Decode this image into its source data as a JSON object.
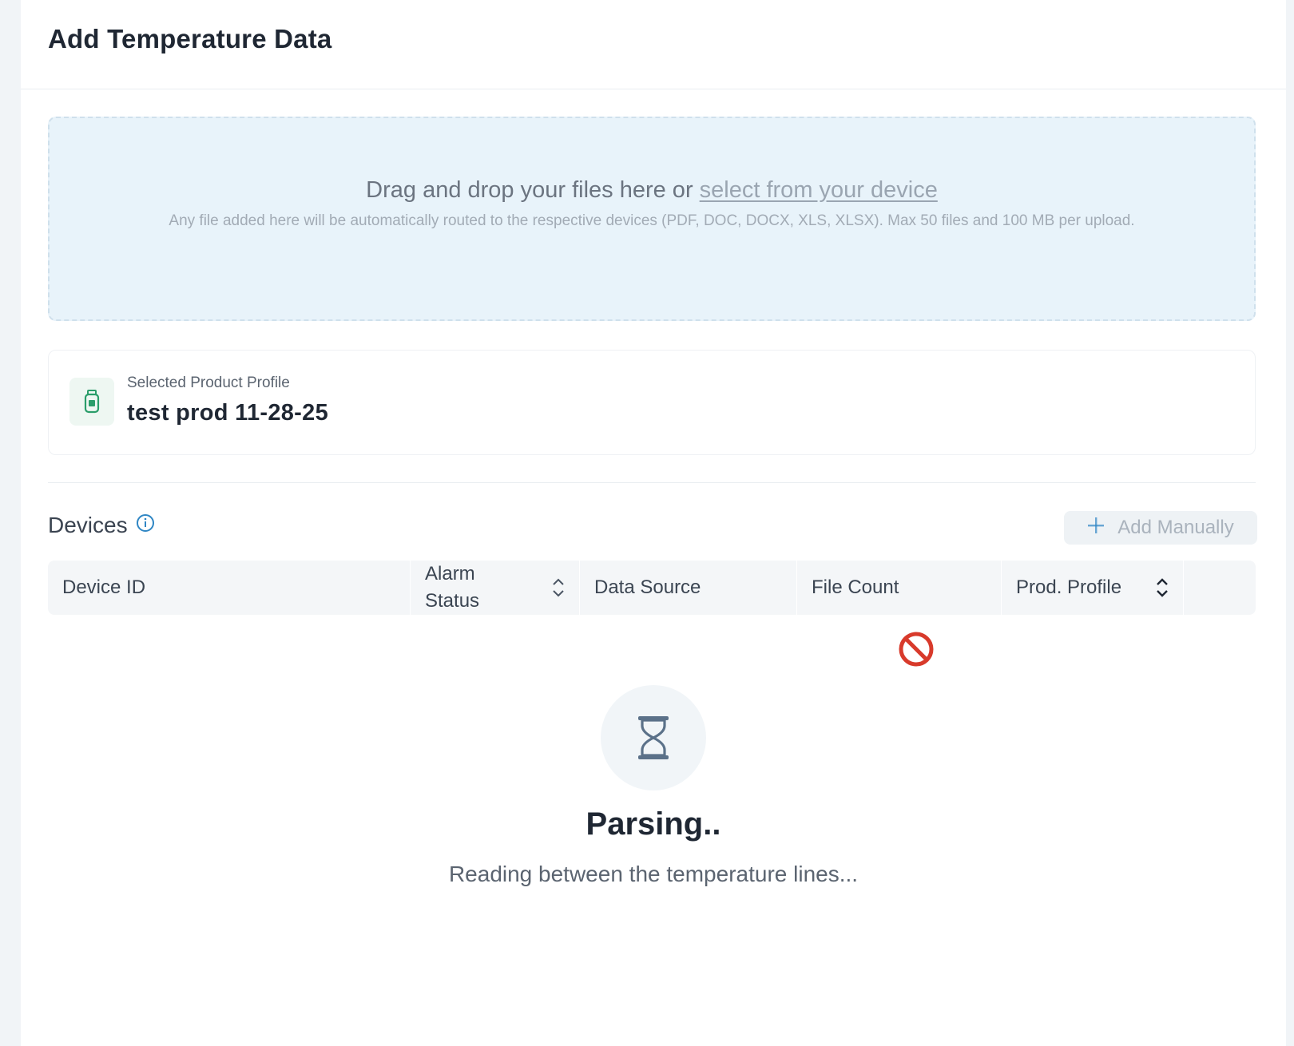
{
  "header": {
    "title": "Add Temperature Data"
  },
  "dropzone": {
    "text": "Drag and drop your files here or ",
    "link": "select from your device",
    "hint": "Any file added here will be automatically routed to the respective devices (PDF, DOC, DOCX, XLS, XLSX). Max 50 files and 100 MB per upload."
  },
  "profile": {
    "label": "Selected Product Profile",
    "value": "test prod 11-28-25",
    "icon": "bottle-icon"
  },
  "devices": {
    "title": "Devices",
    "info_icon": "info-icon",
    "add_button": "Add Manually",
    "columns": [
      "Device ID",
      "Alarm Status",
      "Data Source",
      "File Count",
      "Prod. Profile",
      ""
    ]
  },
  "status": {
    "title": "Parsing..",
    "subtitle": "Reading between the temperature lines...",
    "icon": "hourglass-icon"
  },
  "colors": {
    "accent": "#2f86c4",
    "success": "#2a9d6a",
    "danger": "#d83a2b",
    "dropzone_bg": "#e8f3fa"
  }
}
